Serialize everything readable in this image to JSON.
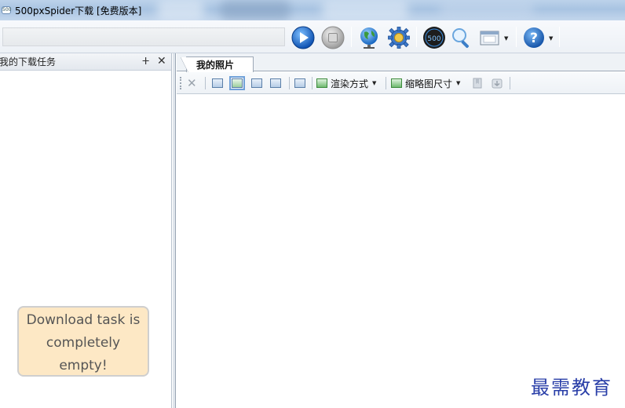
{
  "window": {
    "title": "500pxSpider下载 [免费版本]",
    "app_icon_text": "500"
  },
  "toolbar": {
    "url_value": "",
    "buttons": [
      {
        "name": "play-icon"
      },
      {
        "name": "stop-icon"
      },
      {
        "name": "globe-icon"
      },
      {
        "name": "settings-icon"
      },
      {
        "name": "500px-logo-icon"
      },
      {
        "name": "search-icon"
      },
      {
        "name": "window-icon"
      },
      {
        "name": "help-icon"
      }
    ]
  },
  "left_panel": {
    "title": "我的下载任务",
    "pin_glyph": "ⵜ",
    "close_glyph": "✕",
    "empty_message_lines": [
      "Download task is",
      "completely",
      "empty!"
    ]
  },
  "main": {
    "tab_label": "我的照片",
    "render_mode_label": "渲染方式",
    "thumb_size_label": "缩略图尺寸"
  },
  "watermark": "最需教育",
  "colors": {
    "tooltip_bg": "#fde8c5",
    "accent_blue": "#1f6fd1",
    "watermark": "#2a3fa8"
  }
}
